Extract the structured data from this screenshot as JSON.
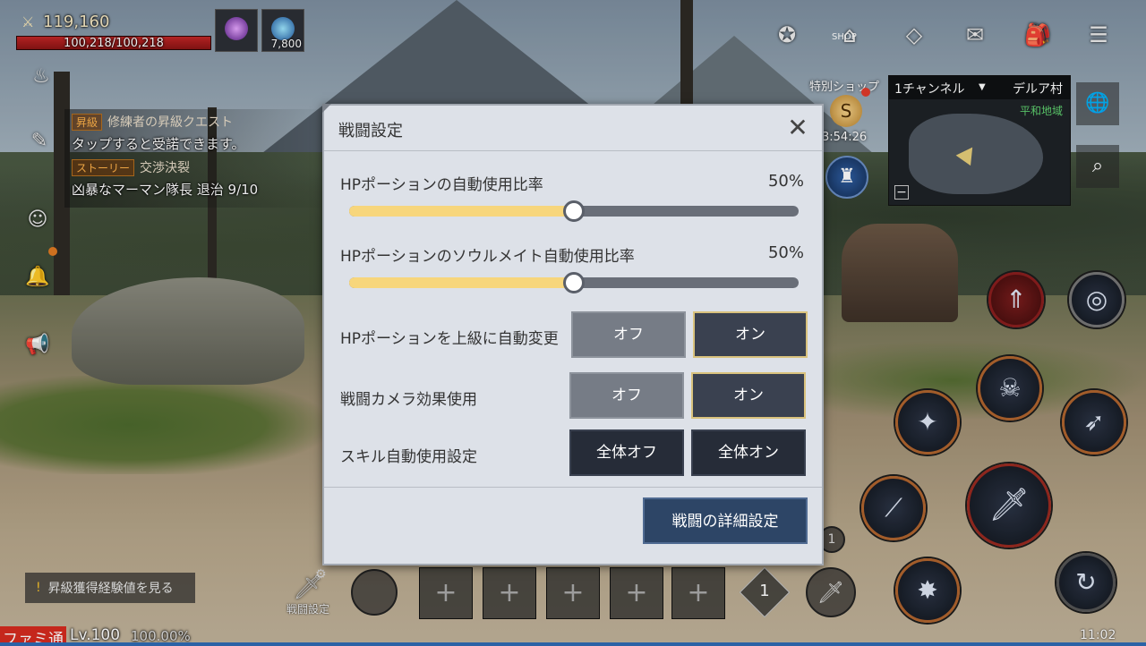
{
  "player": {
    "combat_power": "119,160",
    "hp_text": "100,218/100,218",
    "hp_fraction": 1.0,
    "gem_count": "7,800",
    "level": "Lv.100",
    "exp_percent": "100.00%"
  },
  "quests": [
    {
      "tag": "昇級",
      "title": "修練者の昇級クエスト",
      "desc": "タップすると受諾できます。"
    },
    {
      "tag": "ストーリー",
      "title": "交渉決裂",
      "desc": "凶暴なマーマン隊長 退治 9/10"
    }
  ],
  "exp_button_label": "昇級獲得経験値を見る",
  "watermark": "ファミ通",
  "bottom_bar": {
    "combat_settings_label": "戦闘設定",
    "slot_plus": "+",
    "diamond_count": "1",
    "small_badge": "1"
  },
  "top_menu": {
    "shop_label": "SHOP",
    "special_shop": "特別ショップ",
    "coin_letter": "S",
    "timer": "3:54:26"
  },
  "minimap": {
    "channel": "1チャンネル",
    "village": "デルア村",
    "zone": "平和地域",
    "minus": "−"
  },
  "clock": "11:02",
  "dialog": {
    "title": "戦闘設定",
    "close_symbol": "✕",
    "potion_ratio": {
      "label": "HPポーションの自動使用比率",
      "value_text": "50%",
      "value": 0.5
    },
    "soulmate_ratio": {
      "label": "HPポーションのソウルメイト自動使用比率",
      "value_text": "50%",
      "value": 0.5
    },
    "upgrade_potion": {
      "label": "HPポーションを上級に自動変更",
      "off": "オフ",
      "on": "オン",
      "selected": "on"
    },
    "camera_effect": {
      "label": "戦闘カメラ効果使用",
      "off": "オフ",
      "on": "オン",
      "selected": "on"
    },
    "skill_auto": {
      "label": "スキル自動使用設定",
      "all_off": "全体オフ",
      "all_on": "全体オン"
    },
    "detail_button": "戦闘の詳細設定"
  },
  "colors": {
    "slider_fill": "#f7d67c",
    "slider_track": "#696e78",
    "selected_border": "#d9c27d",
    "hp_bar": "#c22626",
    "zone_text": "#5fd16f"
  }
}
